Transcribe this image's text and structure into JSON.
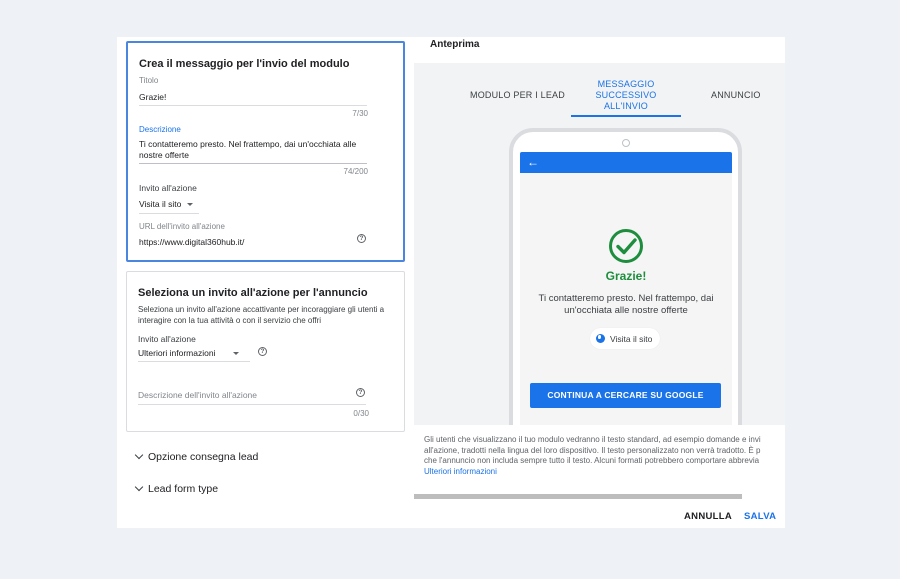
{
  "message_card": {
    "title": "Crea il messaggio per l'invio del modulo",
    "title_label": "Titolo",
    "title_value": "Grazie!",
    "title_counter": "7/30",
    "description_label": "Descrizione",
    "description_value": "Ti contatteremo presto. Nel frattempo, dai un'occhiata alle nostre offerte",
    "description_counter": "74/200",
    "cta_label": "Invito all'azione",
    "cta_value": "Visita il sito",
    "url_label": "URL dell'invito all'azione",
    "url_value": "https://www.digital360hub.it/",
    "help_glyph": "?"
  },
  "ad_cta_card": {
    "title": "Seleziona un invito all'azione per l'annuncio",
    "description": "Seleziona un invito all'azione accattivante per incoraggiare gli utenti a interagire con la tua attività o con il servizio che offri",
    "cta_label": "Invito all'azione",
    "cta_value": "Ulteriori informazioni",
    "cta_desc_placeholder": "Descrizione dell'invito all'azione",
    "cta_desc_counter": "0/30",
    "help_glyph": "?"
  },
  "expanders": [
    {
      "label": "Opzione consegna lead"
    },
    {
      "label": "Lead form type"
    }
  ],
  "preview": {
    "title": "Anteprima",
    "tabs": [
      {
        "label": "MODULO PER I LEAD",
        "active": false
      },
      {
        "label": "MESSAGGIO SUCCESSIVO ALL'INVIO",
        "active": true
      },
      {
        "label": "ANNUNCIO",
        "active": false
      }
    ],
    "phone": {
      "back_icon": "←",
      "heading": "Grazie!",
      "message": "Ti contatteremo presto. Nel frattempo, dai un'occhiata alle nostre offerte",
      "chip_label": "Visita il sito",
      "button_label": "CONTINUA A CERCARE SU GOOGLE"
    },
    "info_lines": [
      "Gli utenti che visualizzano il tuo modulo vedranno il testo standard, ad esempio domande e invi",
      "all'azione, tradotti nella lingua del loro dispositivo. Il testo personalizzato non verrà tradotto. È p",
      "che l'annuncio non includa sempre tutto il testo. Alcuni formati potrebbero comportare abbrevia"
    ],
    "info_link": "Ulteriori informazioni"
  },
  "footer": {
    "cancel_label": "ANNULLA",
    "save_label": "SALVA"
  },
  "colors": {
    "accent": "#1a73e8",
    "success": "#1e8e3e",
    "page_bg": "#eef1f6"
  }
}
